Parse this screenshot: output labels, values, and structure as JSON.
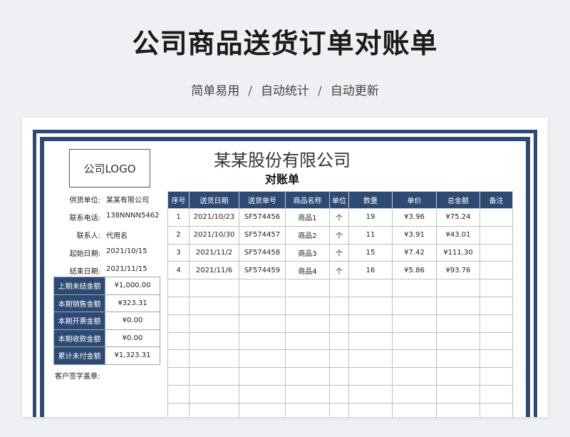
{
  "header": {
    "title": "公司商品送货订单对账单",
    "subtitle_parts": [
      "简单易用",
      "自动统计",
      "自动更新"
    ],
    "separator": "/"
  },
  "sheet": {
    "logo": "公司LOGO",
    "company": "某某股份有限公司",
    "doc_title": "对账单",
    "info": [
      {
        "label": "供货单位:",
        "value": "某某有限公司"
      },
      {
        "label": "联系电话:",
        "value": "138NNNN5462"
      },
      {
        "label": "联系人:",
        "value": "代用名"
      },
      {
        "label": "起始日期:",
        "value": "2021/10/15"
      },
      {
        "label": "结束日期:",
        "value": "2021/11/15"
      }
    ],
    "summary": [
      {
        "label": "上期未结金额",
        "value": "¥1,000.00"
      },
      {
        "label": "本期销售金额",
        "value": "¥323.31"
      },
      {
        "label": "本期开票金额",
        "value": "¥0.00"
      },
      {
        "label": "本期收款金额",
        "value": "¥0.00"
      },
      {
        "label": "累计未付金额",
        "value": "¥1,323.31"
      }
    ],
    "sign_label": "客户签字盖章:",
    "columns": [
      "序号",
      "送货日期",
      "送货单号",
      "商品名称",
      "单位",
      "数量",
      "单价",
      "总金额",
      "备注"
    ],
    "rows": [
      [
        "1",
        "2021/10/23",
        "SF574456",
        "商品1",
        "个",
        "19",
        "¥3.96",
        "¥75.24",
        ""
      ],
      [
        "2",
        "2021/10/30",
        "SF574457",
        "商品2",
        "个",
        "11",
        "¥3.91",
        "¥43.01",
        ""
      ],
      [
        "3",
        "2021/11/2",
        "SF574458",
        "商品3",
        "个",
        "15",
        "¥7.42",
        "¥111.30",
        ""
      ],
      [
        "4",
        "2021/11/6",
        "SF574459",
        "商品4",
        "个",
        "16",
        "¥5.86",
        "¥93.76",
        ""
      ],
      [
        "",
        "",
        "",
        "",
        "",
        "",
        "",
        "",
        ""
      ],
      [
        "",
        "",
        "",
        "",
        "",
        "",
        "",
        "",
        ""
      ],
      [
        "",
        "",
        "",
        "",
        "",
        "",
        "",
        "",
        ""
      ],
      [
        "",
        "",
        "",
        "",
        "",
        "",
        "",
        "",
        ""
      ],
      [
        "",
        "",
        "",
        "",
        "",
        "",
        "",
        "",
        ""
      ],
      [
        "",
        "",
        "",
        "",
        "",
        "",
        "",
        "",
        ""
      ],
      [
        "",
        "",
        "",
        "",
        "",
        "",
        "",
        "",
        ""
      ],
      [
        "",
        "",
        "",
        "",
        "",
        "",
        "",
        "",
        ""
      ]
    ],
    "accent_color": "#2d4a74"
  }
}
